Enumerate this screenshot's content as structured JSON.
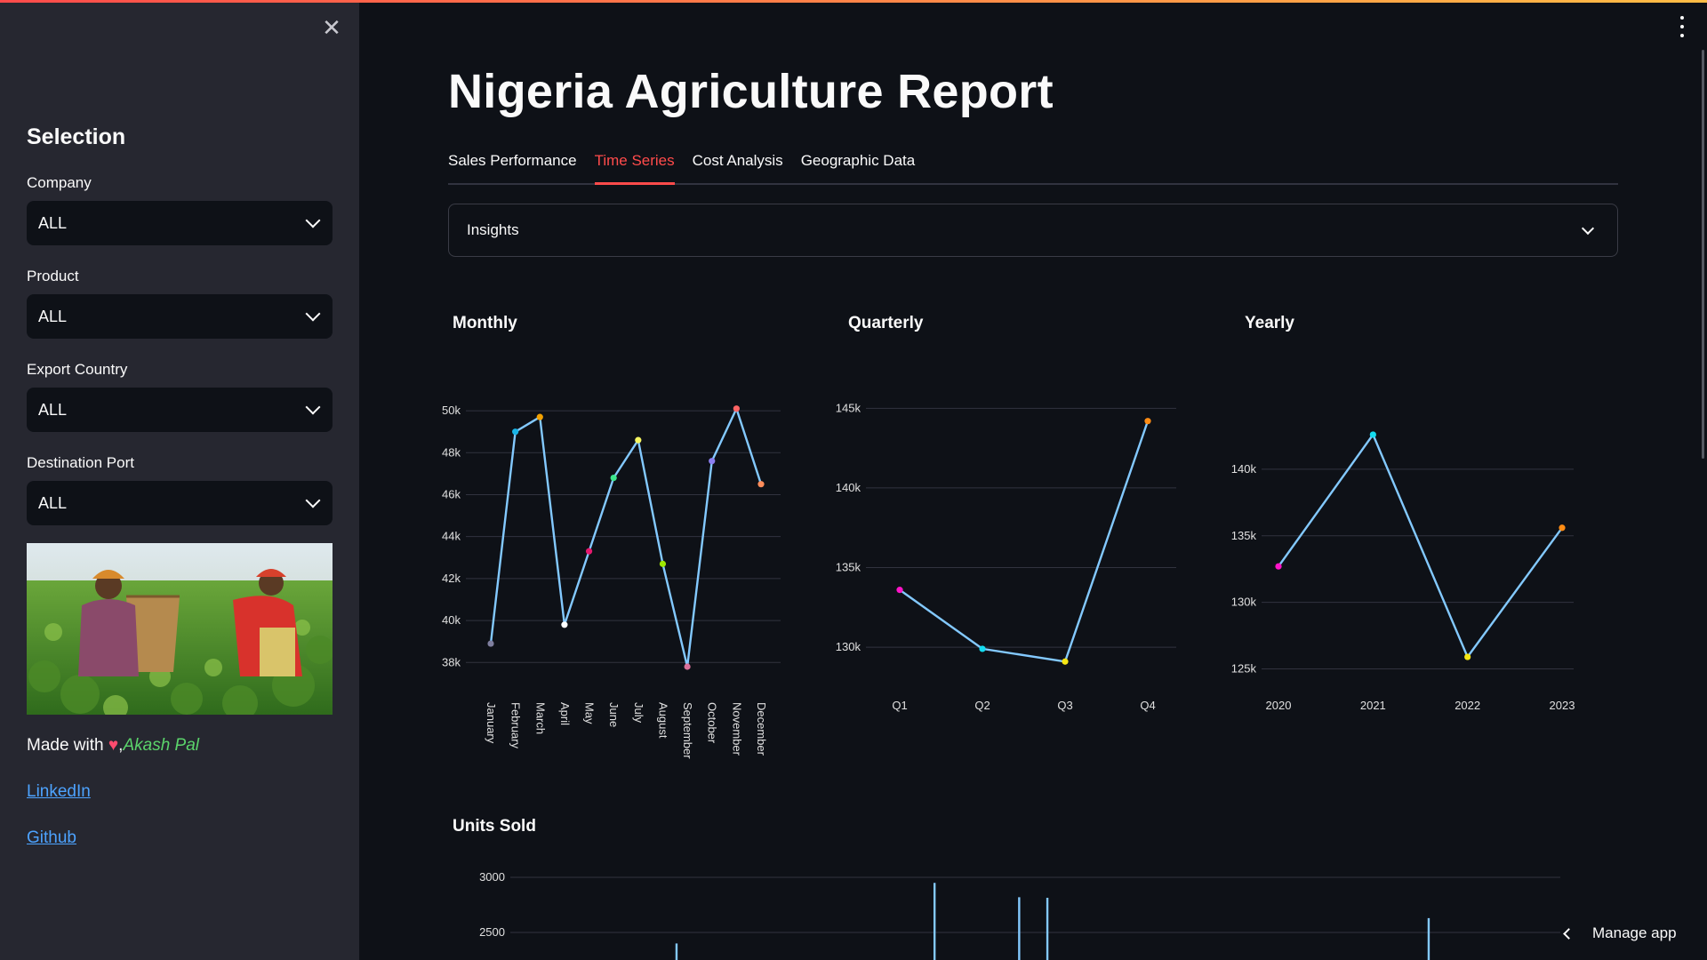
{
  "sidebar": {
    "close_icon": "close-icon",
    "heading": "Selection",
    "filters": [
      {
        "label": "Company",
        "value": "ALL"
      },
      {
        "label": "Product",
        "value": "ALL"
      },
      {
        "label": "Export Country",
        "value": "ALL"
      },
      {
        "label": "Destination Port",
        "value": "ALL"
      }
    ],
    "made_with": "Made with",
    "author": "Akash Pal",
    "links": {
      "linkedin": "LinkedIn",
      "github": "Github"
    }
  },
  "main": {
    "title": "Nigeria Agriculture Report",
    "tabs": [
      {
        "label": "Sales Performance"
      },
      {
        "label": "Time Series"
      },
      {
        "label": "Cost Analysis"
      },
      {
        "label": "Geographic Data"
      }
    ],
    "active_tab": "Time Series",
    "expander_label": "Insights",
    "chart_titles": {
      "monthly": "Monthly",
      "quarterly": "Quarterly",
      "yearly": "Yearly",
      "units": "Units Sold"
    }
  },
  "footer": {
    "manage_app": "Manage app"
  },
  "colors": {
    "accent": "#ff4b4b",
    "line": "#83c9ff",
    "link": "#4da3ff"
  },
  "chart_data": [
    {
      "type": "line",
      "title": "Monthly",
      "categories": [
        "January",
        "February",
        "March",
        "April",
        "May",
        "June",
        "July",
        "August",
        "September",
        "October",
        "November",
        "December"
      ],
      "values": [
        38900,
        49000,
        49700,
        39800,
        43300,
        46800,
        48600,
        42700,
        37800,
        47600,
        50100,
        46500
      ],
      "point_colors": [
        "#7f7f9f",
        "#19b4e6",
        "#f2a100",
        "#ffffff",
        "#e6196e",
        "#3ce68c",
        "#f5f560",
        "#9ee600",
        "#d9709a",
        "#8c7ff0",
        "#ff6464",
        "#ff8c5a"
      ],
      "yticks": [
        38000,
        40000,
        42000,
        44000,
        46000,
        48000,
        50000
      ],
      "ytick_labels": [
        "38k",
        "40k",
        "42k",
        "44k",
        "46k",
        "48k",
        "50k"
      ],
      "ylim": [
        37800,
        50300
      ]
    },
    {
      "type": "line",
      "title": "Quarterly",
      "categories": [
        "Q1",
        "Q2",
        "Q3",
        "Q4"
      ],
      "values": [
        133600,
        129900,
        129100,
        144200
      ],
      "point_colors": [
        "#ff14c8",
        "#14dcf0",
        "#f5e614",
        "#ff8c14"
      ],
      "yticks": [
        130000,
        135000,
        140000,
        145000
      ],
      "ytick_labels": [
        "130k",
        "135k",
        "140k",
        "145k"
      ],
      "ylim": [
        128500,
        145800
      ]
    },
    {
      "type": "line",
      "title": "Yearly",
      "categories": [
        "2020",
        "2021",
        "2022",
        "2023"
      ],
      "values": [
        132700,
        142600,
        125900,
        135600
      ],
      "point_colors": [
        "#ff14c8",
        "#14dcf0",
        "#f5e614",
        "#ff8c14"
      ],
      "yticks": [
        125000,
        130000,
        135000,
        140000
      ],
      "ytick_labels": [
        "125k",
        "130k",
        "135k",
        "140k"
      ],
      "ylim": [
        124500,
        144000
      ]
    },
    {
      "type": "line",
      "title": "Units Sold",
      "yticks": [
        2500,
        3000
      ],
      "ytick_labels": [
        "2500",
        "3000"
      ],
      "spikes": [
        {
          "pos": 0.154,
          "value": 2400
        },
        {
          "pos": 0.401,
          "value": 2950
        },
        {
          "pos": 0.482,
          "value": 2820
        },
        {
          "pos": 0.509,
          "value": 2815
        },
        {
          "pos": 0.874,
          "value": 2630
        }
      ]
    }
  ]
}
